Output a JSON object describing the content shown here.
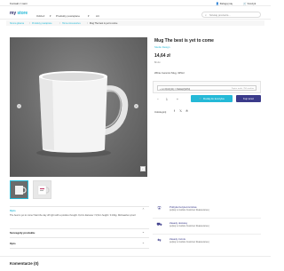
{
  "topbar": {
    "contact": "Kontakt z nami",
    "signin": "Zaloguj się",
    "cart": "Koszyk"
  },
  "header": {
    "logo_primary": "my",
    "logo_accent": "store",
    "nav": [
      "Odzież",
      "Produkty powiązane",
      "Art"
    ],
    "search_placeholder": "Szukaj products..."
  },
  "breadcrumb": [
    "Strona główna",
    "Produkty powiązane",
    "Home Accessories",
    "Mug The best is yet to come"
  ],
  "product": {
    "title": "Mug The best is yet to come",
    "brand": "Studio Design",
    "price": "14,64 zł",
    "tax": "Brutto",
    "reference": "White Ceramic Mug, 325ml",
    "customization_placeholder": "+ Lot 0(A2)(11) = Klatka(Z)(Wid)",
    "customization_hint": "Zapisz maks. 250 znaków",
    "quantity": "1",
    "add_to_cart": "Dodaj do koszyka",
    "buy_now": "Kup teraz",
    "share_label": "Udostępnij"
  },
  "reassurance": [
    {
      "title": "Polityka bezpieczeństwa",
      "text": "(edytuj w module Customer Reassurance)",
      "icon": "shield-icon"
    },
    {
      "title": "Zasady dostawy",
      "text": "(edytuj w module Customer Reassurance)",
      "icon": "truck-icon"
    },
    {
      "title": "Zasady zwrotu",
      "text": "(edytuj w module Customer Reassurance)",
      "icon": "return-icon"
    }
  ],
  "accordion": {
    "description_title": "Opis",
    "description_text": "The best is yet to come! Start the day off right with a positive thought. 8,2cm diameter / 9,5cm height / 0.43kg. Dishwasher-proof.",
    "details_title": "Szczegóły produktu",
    "extra_title": "Opis"
  },
  "comments_title": "Komentarze (0)",
  "colors": {
    "accent": "#24b9d7",
    "brand_dark": "#3a3a8a"
  }
}
